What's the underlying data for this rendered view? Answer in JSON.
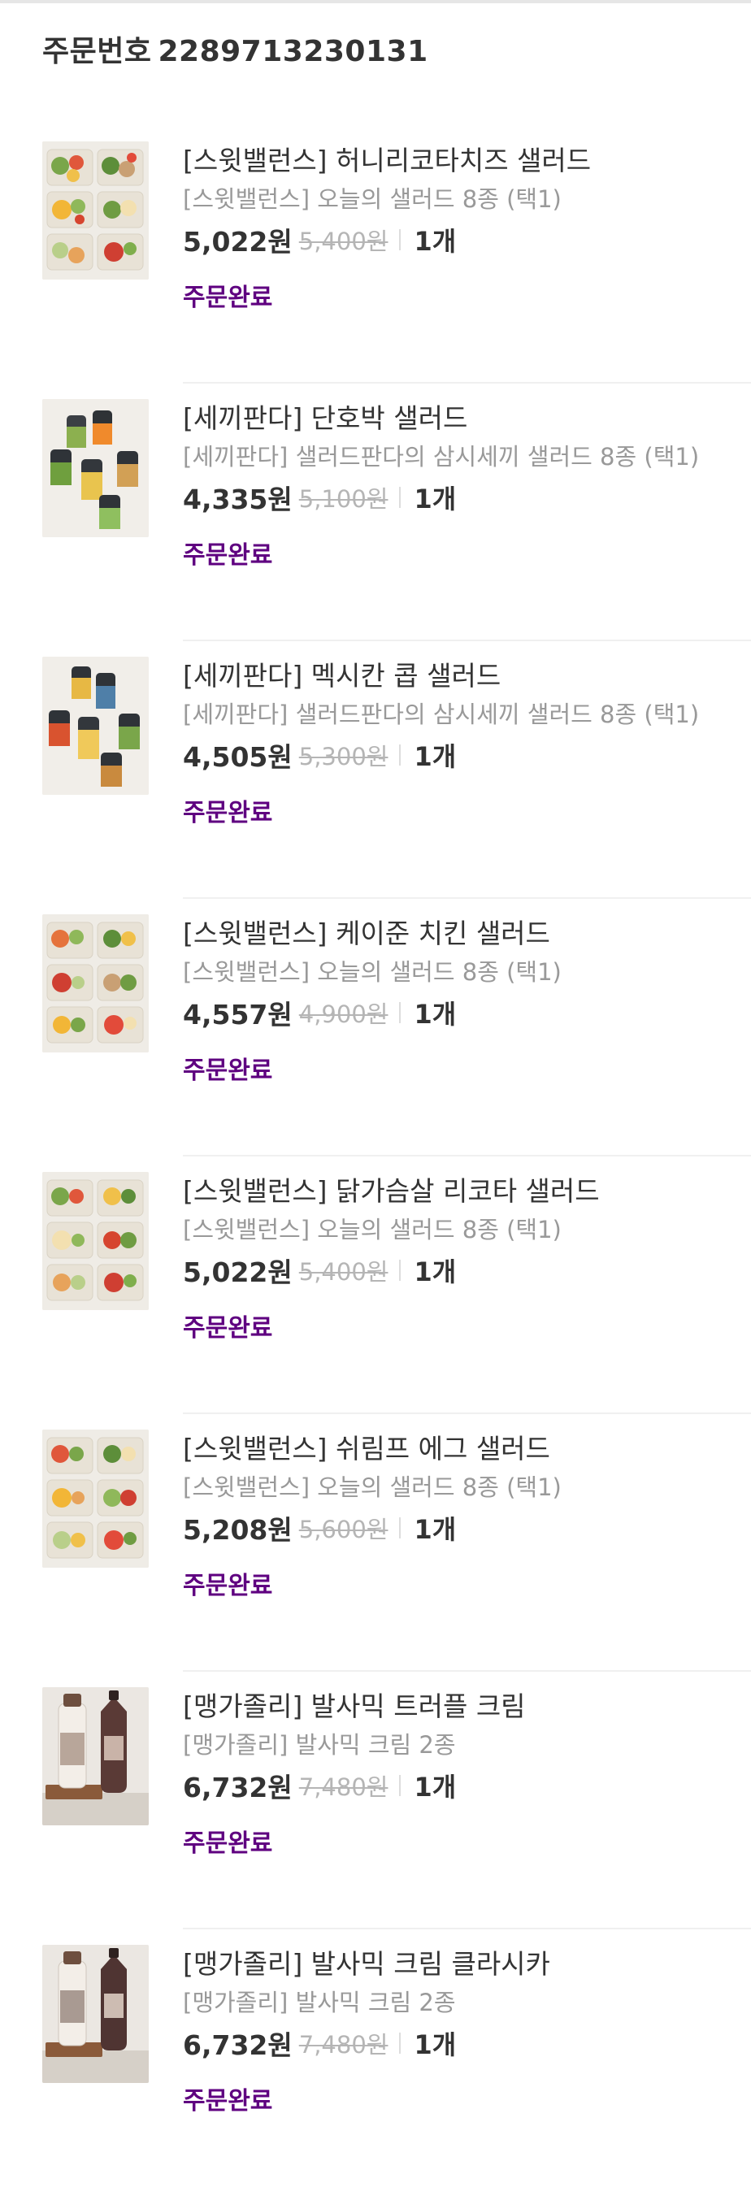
{
  "order": {
    "label": "주문번호",
    "number": "2289713230131"
  },
  "items": [
    {
      "title": "[스윗밸런스] 허니리코타치즈 샐러드",
      "subtitle": "[스윗밸런스] 오늘의 샐러드 8종 (택1)",
      "price": "5,022원",
      "original_price": "5,400원",
      "quantity": "1개",
      "status": "주문완료",
      "image": "salad-box-icon"
    },
    {
      "title": "[세끼판다] 단호박 샐러드",
      "subtitle": "[세끼판다] 샐러드판다의 삼시세끼 샐러드 8종 (택1)",
      "price": "4,335원",
      "original_price": "5,100원",
      "quantity": "1개",
      "status": "주문완료",
      "image": "salad-jar-icon"
    },
    {
      "title": "[세끼판다] 멕시칸 콥 샐러드",
      "subtitle": "[세끼판다] 샐러드판다의 삼시세끼 샐러드 8종 (택1)",
      "price": "4,505원",
      "original_price": "5,300원",
      "quantity": "1개",
      "status": "주문완료",
      "image": "salad-jar-icon"
    },
    {
      "title": "[스윗밸런스] 케이준 치킨 샐러드",
      "subtitle": "[스윗밸런스] 오늘의 샐러드 8종 (택1)",
      "price": "4,557원",
      "original_price": "4,900원",
      "quantity": "1개",
      "status": "주문완료",
      "image": "salad-box-icon"
    },
    {
      "title": "[스윗밸런스] 닭가슴살 리코타 샐러드",
      "subtitle": "[스윗밸런스] 오늘의 샐러드 8종 (택1)",
      "price": "5,022원",
      "original_price": "5,400원",
      "quantity": "1개",
      "status": "주문완료",
      "image": "salad-box-icon"
    },
    {
      "title": "[스윗밸런스] 쉬림프 에그 샐러드",
      "subtitle": "[스윗밸런스] 오늘의 샐러드 8종 (택1)",
      "price": "5,208원",
      "original_price": "5,600원",
      "quantity": "1개",
      "status": "주문완료",
      "image": "salad-box-icon"
    },
    {
      "title": "[맹가졸리] 발사믹 트러플 크림",
      "subtitle": "[맹가졸리] 발사믹 크림 2종",
      "price": "6,732원",
      "original_price": "7,480원",
      "quantity": "1개",
      "status": "주문완료",
      "image": "balsamic-bottle-icon"
    },
    {
      "title": "[맹가졸리] 발사믹 크림 클라시카",
      "subtitle": "[맹가졸리] 발사믹 크림 2종",
      "price": "6,732원",
      "original_price": "7,480원",
      "quantity": "1개",
      "status": "주문완료",
      "image": "balsamic-bottle-icon"
    }
  ],
  "colors": {
    "accent": "#5f0080",
    "text": "#333333",
    "muted": "#999999",
    "strike": "#b5b5b5"
  }
}
